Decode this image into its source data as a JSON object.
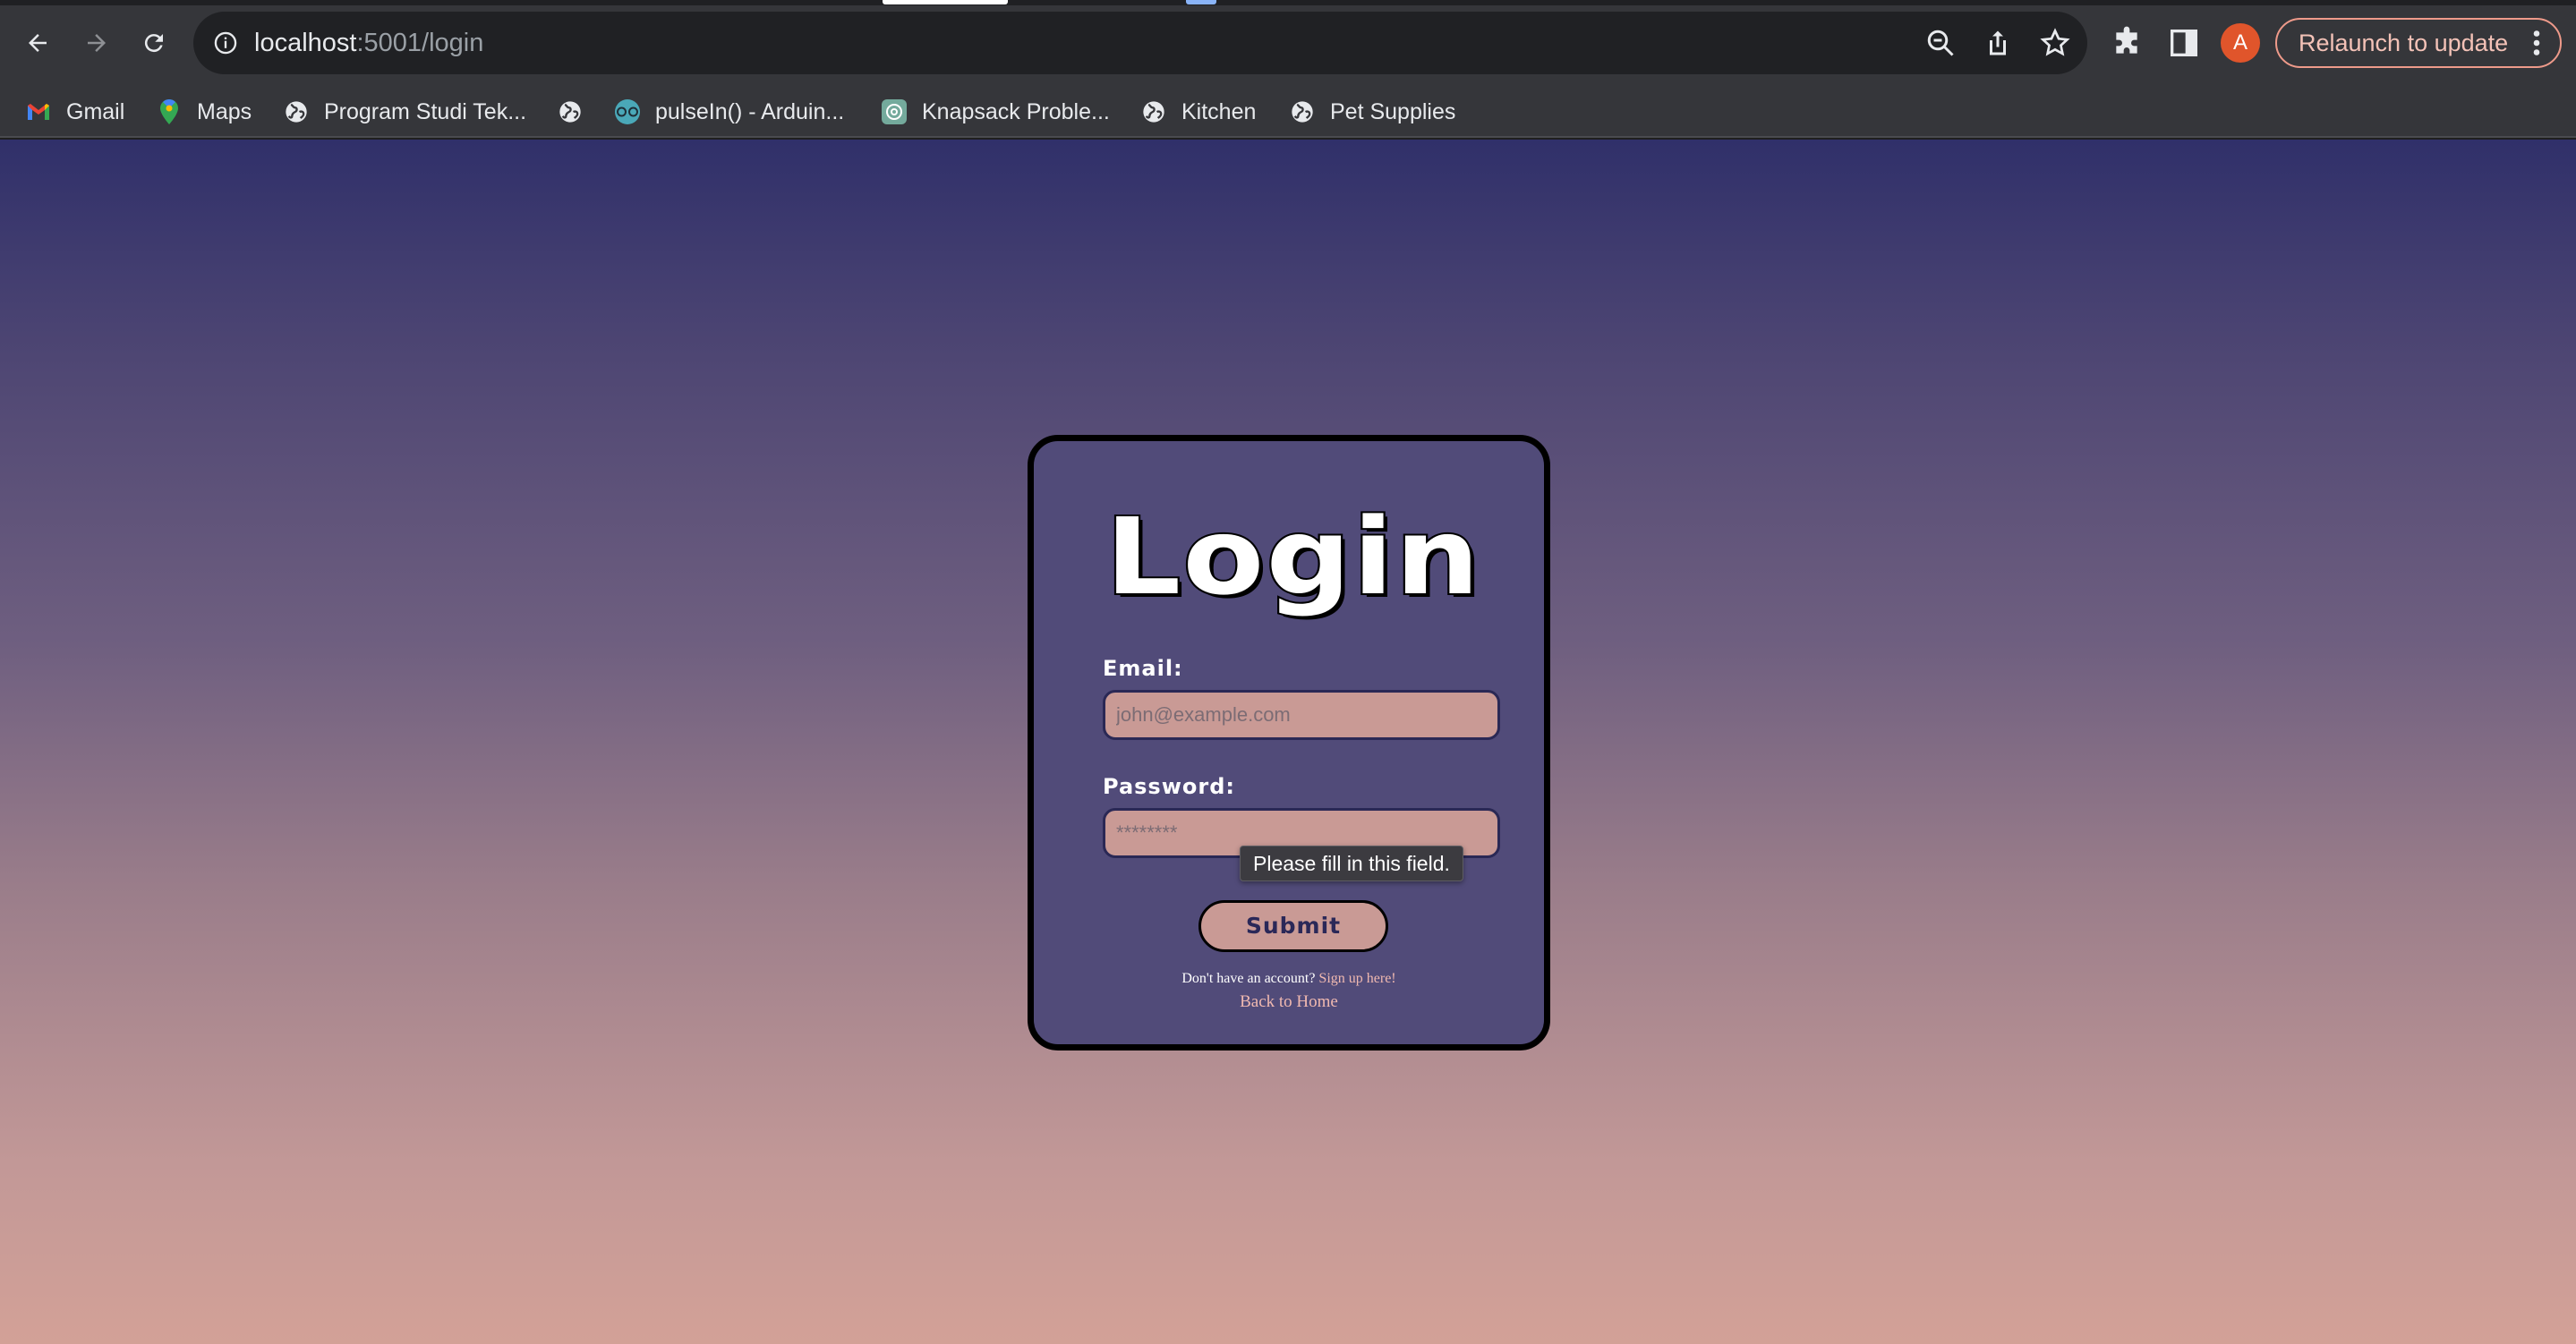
{
  "browser": {
    "url_host": "localhost",
    "url_path": ":5001/login",
    "avatar_letter": "A",
    "relaunch_label": "Relaunch to update",
    "icons": {
      "back": "back-arrow-icon",
      "forward": "forward-arrow-icon",
      "reload": "reload-icon",
      "info": "info-icon",
      "zoom": "zoom-icon",
      "share": "share-icon",
      "star": "star-icon",
      "extensions": "puzzle-icon",
      "side_panel": "side-panel-icon",
      "menu": "kebab-menu-icon"
    },
    "colors": {
      "accent": "#e0552b",
      "relaunch_border": "#ee9a8a"
    }
  },
  "bookmarks": [
    {
      "label": "Gmail",
      "icon": "gmail-icon"
    },
    {
      "label": "Maps",
      "icon": "maps-pin-icon"
    },
    {
      "label": "Program Studi Tek...",
      "icon": "globe-icon"
    },
    {
      "label": "",
      "icon": "globe-icon"
    },
    {
      "label": "pulseIn() - Arduin...",
      "icon": "arduino-icon"
    },
    {
      "label": "Knapsack Proble...",
      "icon": "openai-icon"
    },
    {
      "label": "Kitchen",
      "icon": "globe-icon"
    },
    {
      "label": "Pet Supplies",
      "icon": "globe-icon"
    }
  ],
  "login": {
    "title": "Login",
    "email_label": "Email:",
    "email_placeholder": "john@example.com",
    "password_label": "Password:",
    "password_placeholder": "********",
    "submit_label": "Submit",
    "signup_prompt": "Don't have an account?",
    "signup_link": "Sign up here!",
    "home_link": "Back to Home",
    "validation_tooltip": "Please fill in this field."
  },
  "theme": {
    "card_bg": "#514b79",
    "field_bg": "#c99a95",
    "link_color": "#f0b9b0"
  }
}
